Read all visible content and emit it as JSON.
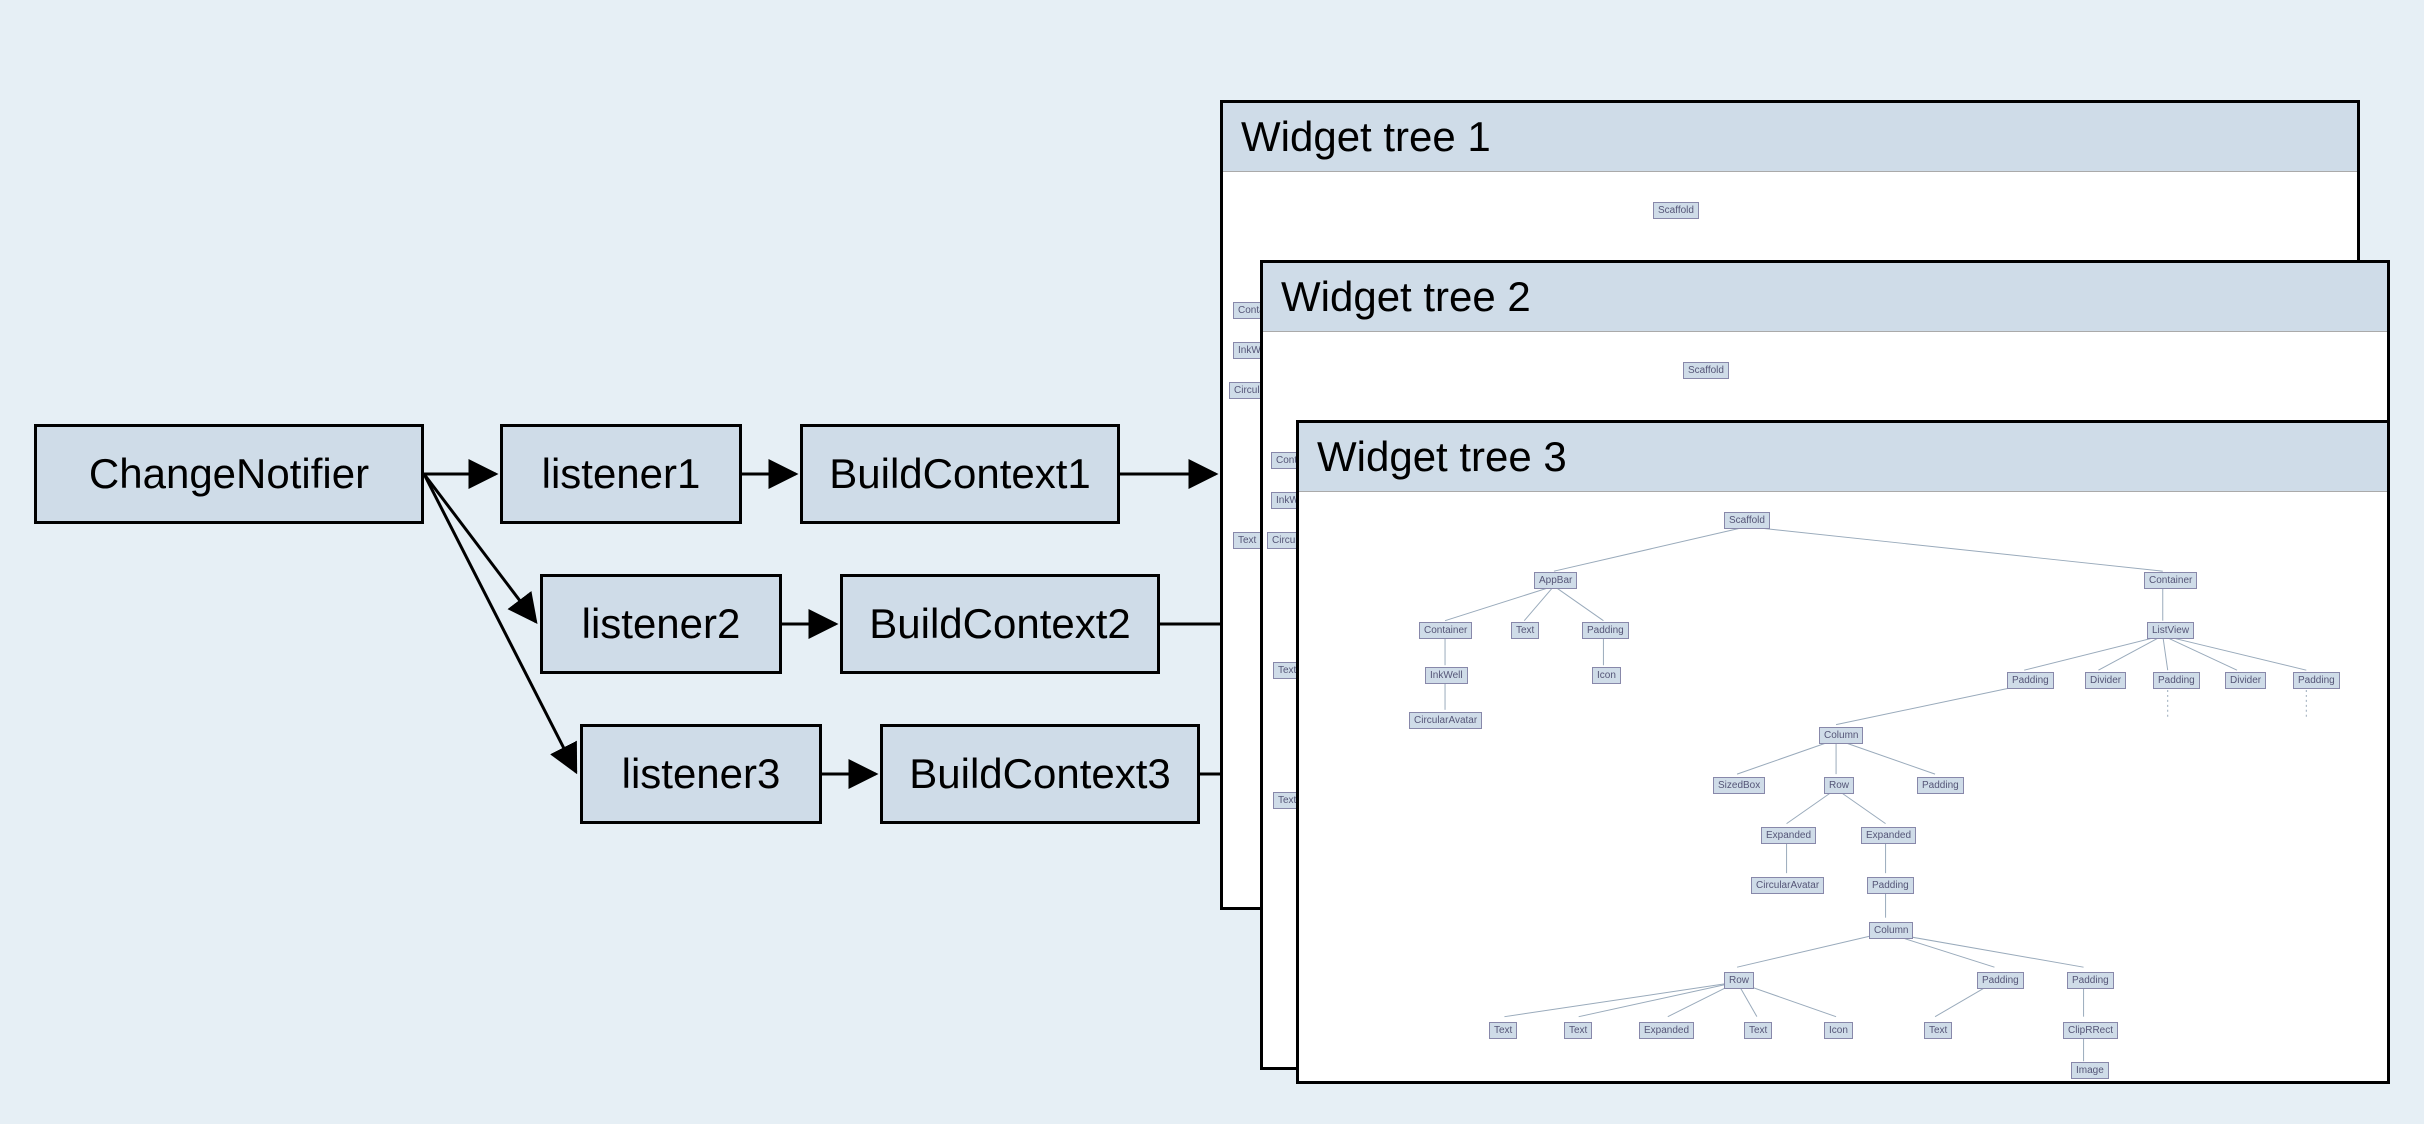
{
  "nodes": {
    "changeNotifier": "ChangeNotifier",
    "listener1": "listener1",
    "listener2": "listener2",
    "listener3": "listener3",
    "buildContext1": "BuildContext1",
    "buildContext2": "BuildContext2",
    "buildContext3": "BuildContext3"
  },
  "panels": {
    "tree1": "Widget tree 1",
    "tree2": "Widget tree 2",
    "tree3": "Widget tree 3"
  },
  "mini": {
    "scaffold": "Scaffold",
    "appBar": "AppBar",
    "container": "Container",
    "text": "Text",
    "padding": "Padding",
    "inkWell": "InkWell",
    "icon": "Icon",
    "circularAvatar": "CircularAvatar",
    "listView": "ListView",
    "divider": "Divider",
    "column": "Column",
    "sizedBox": "SizedBox",
    "row": "Row",
    "expanded": "Expanded",
    "clipRRect": "ClipRRect",
    "image": "Image"
  }
}
